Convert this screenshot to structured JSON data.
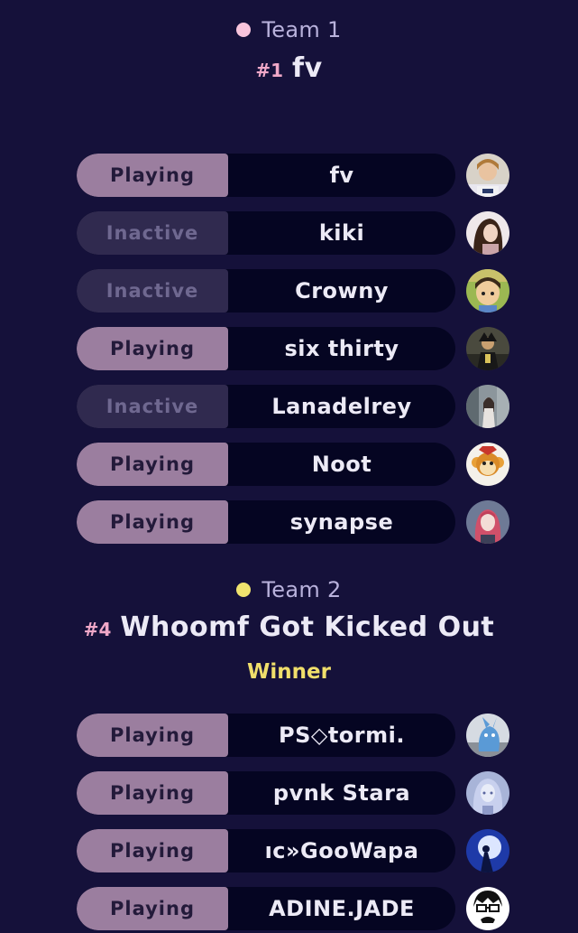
{
  "teams": [
    {
      "label": "Team 1",
      "dot_color": "#f8c4dc",
      "rank": "#1",
      "name": "fv",
      "winner": "",
      "players": [
        {
          "status": "Playing",
          "active": true,
          "name": "fv",
          "avatar": "avatar-blonde-shirt"
        },
        {
          "status": "Inactive",
          "active": false,
          "name": "kiki",
          "avatar": "avatar-photo-woman"
        },
        {
          "status": "Inactive",
          "active": false,
          "name": "Crowny",
          "avatar": "avatar-cartoon-boy"
        },
        {
          "status": "Playing",
          "active": true,
          "name": "six thirty",
          "avatar": "avatar-dark-figure"
        },
        {
          "status": "Inactive",
          "active": false,
          "name": "Lanadelrey",
          "avatar": "avatar-photo-room"
        },
        {
          "status": "Playing",
          "active": true,
          "name": "Noot",
          "avatar": "avatar-monkey"
        },
        {
          "status": "Playing",
          "active": true,
          "name": "synapse",
          "avatar": "avatar-anime-girl"
        }
      ]
    },
    {
      "label": "Team 2",
      "dot_color": "#f0e36e",
      "rank": "#4",
      "name": "Whoomf Got Kicked Out",
      "winner": "Winner",
      "players": [
        {
          "status": "Playing",
          "active": true,
          "name": "PS◇tormi.",
          "avatar": "avatar-blue-creature"
        },
        {
          "status": "Playing",
          "active": true,
          "name": "pvnk Stara",
          "avatar": "avatar-anime-sketch"
        },
        {
          "status": "Playing",
          "active": true,
          "name": "ıc»GooWapa",
          "avatar": "avatar-moon-silhouette"
        },
        {
          "status": "Playing",
          "active": true,
          "name": "ADINE.JADE",
          "avatar": "avatar-manga-face"
        }
      ]
    }
  ]
}
